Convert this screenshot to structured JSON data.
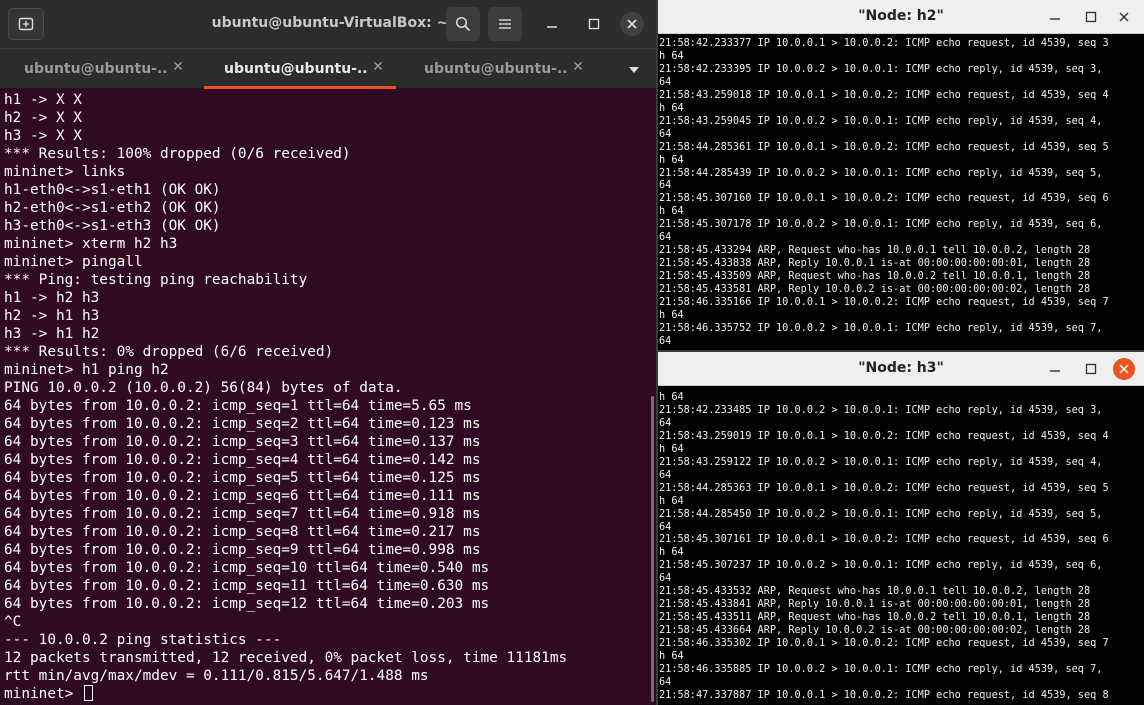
{
  "terminal": {
    "title": "ubuntu@ubuntu-VirtualBox: ~",
    "tabs": [
      {
        "label": "ubuntu@ubuntu-...",
        "active": false
      },
      {
        "label": "ubuntu@ubuntu-...",
        "active": true
      },
      {
        "label": "ubuntu@ubuntu-...",
        "active": false
      }
    ],
    "lines": [
      "h1 -> X X",
      "h2 -> X X",
      "h3 -> X X",
      "*** Results: 100% dropped (0/6 received)",
      "mininet> links",
      "h1-eth0<->s1-eth1 (OK OK)",
      "h2-eth0<->s1-eth2 (OK OK)",
      "h3-eth0<->s1-eth3 (OK OK)",
      "mininet> xterm h2 h3",
      "mininet> pingall",
      "*** Ping: testing ping reachability",
      "h1 -> h2 h3",
      "h2 -> h1 h3",
      "h3 -> h1 h2",
      "*** Results: 0% dropped (6/6 received)",
      "mininet> h1 ping h2",
      "PING 10.0.0.2 (10.0.0.2) 56(84) bytes of data.",
      "64 bytes from 10.0.0.2: icmp_seq=1 ttl=64 time=5.65 ms",
      "64 bytes from 10.0.0.2: icmp_seq=2 ttl=64 time=0.123 ms",
      "64 bytes from 10.0.0.2: icmp_seq=3 ttl=64 time=0.137 ms",
      "64 bytes from 10.0.0.2: icmp_seq=4 ttl=64 time=0.142 ms",
      "64 bytes from 10.0.0.2: icmp_seq=5 ttl=64 time=0.125 ms",
      "64 bytes from 10.0.0.2: icmp_seq=6 ttl=64 time=0.111 ms",
      "64 bytes from 10.0.0.2: icmp_seq=7 ttl=64 time=0.918 ms",
      "64 bytes from 10.0.0.2: icmp_seq=8 ttl=64 time=0.217 ms",
      "64 bytes from 10.0.0.2: icmp_seq=9 ttl=64 time=0.998 ms",
      "64 bytes from 10.0.0.2: icmp_seq=10 ttl=64 time=0.540 ms",
      "64 bytes from 10.0.0.2: icmp_seq=11 ttl=64 time=0.630 ms",
      "64 bytes from 10.0.0.2: icmp_seq=12 ttl=64 time=0.203 ms",
      "^C",
      "--- 10.0.0.2 ping statistics ---",
      "12 packets transmitted, 12 received, 0% packet loss, time 11181ms",
      "rtt min/avg/max/mdev = 0.111/0.815/5.647/1.488 ms"
    ],
    "prompt": "mininet> "
  },
  "node_h2": {
    "title": "\"Node: h2\"",
    "lines": [
      "21:58:42.233377 IP 10.0.0.1 > 10.0.0.2: ICMP echo request, id 4539, seq 3, lengt",
      "h 64",
      "21:58:42.233395 IP 10.0.0.2 > 10.0.0.1: ICMP echo reply, id 4539, seq 3, length",
      "64",
      "21:58:43.259018 IP 10.0.0.1 > 10.0.0.2: ICMP echo request, id 4539, seq 4, lengt",
      "h 64",
      "21:58:43.259045 IP 10.0.0.2 > 10.0.0.1: ICMP echo reply, id 4539, seq 4, length",
      "64",
      "21:58:44.285361 IP 10.0.0.1 > 10.0.0.2: ICMP echo request, id 4539, seq 5, lengt",
      "h 64",
      "21:58:44.285439 IP 10.0.0.2 > 10.0.0.1: ICMP echo reply, id 4539, seq 5, length",
      "64",
      "21:58:45.307160 IP 10.0.0.1 > 10.0.0.2: ICMP echo request, id 4539, seq 6, lengt",
      "h 64",
      "21:58:45.307178 IP 10.0.0.2 > 10.0.0.1: ICMP echo reply, id 4539, seq 6, length",
      "64",
      "21:58:45.433294 ARP, Request who-has 10.0.0.1 tell 10.0.0.2, length 28",
      "21:58:45.433838 ARP, Reply 10.0.0.1 is-at 00:00:00:00:00:01, length 28",
      "21:58:45.433509 ARP, Request who-has 10.0.0.2 tell 10.0.0.1, length 28",
      "21:58:45.433581 ARP, Reply 10.0.0.2 is-at 00:00:00:00:00:02, length 28",
      "21:58:46.335166 IP 10.0.0.1 > 10.0.0.2: ICMP echo request, id 4539, seq 7, lengt",
      "h 64",
      "21:58:46.335752 IP 10.0.0.2 > 10.0.0.1: ICMP echo reply, id 4539, seq 7, length",
      "64"
    ]
  },
  "node_h3": {
    "title": "\"Node: h3\"",
    "lines": [
      "h 64",
      "21:58:42.233485 IP 10.0.0.2 > 10.0.0.1: ICMP echo reply, id 4539, seq 3, length",
      "64",
      "21:58:43.259019 IP 10.0.0.1 > 10.0.0.2: ICMP echo request, id 4539, seq 4, lengt",
      "h 64",
      "21:58:43.259122 IP 10.0.0.2 > 10.0.0.1: ICMP echo reply, id 4539, seq 4, length",
      "64",
      "21:58:44.285363 IP 10.0.0.1 > 10.0.0.2: ICMP echo request, id 4539, seq 5, lengt",
      "h 64",
      "21:58:44.285450 IP 10.0.0.2 > 10.0.0.1: ICMP echo reply, id 4539, seq 5, length",
      "64",
      "21:58:45.307161 IP 10.0.0.1 > 10.0.0.2: ICMP echo request, id 4539, seq 6, lengt",
      "h 64",
      "21:58:45.307237 IP 10.0.0.2 > 10.0.0.1: ICMP echo reply, id 4539, seq 6, length",
      "64",
      "21:58:45.433532 ARP, Request who-has 10.0.0.1 tell 10.0.0.2, length 28",
      "21:58:45.433841 ARP, Reply 10.0.0.1 is-at 00:00:00:00:00:01, length 28",
      "21:58:45.433511 ARP, Request who-has 10.0.0.2 tell 10.0.0.1, length 28",
      "21:58:45.433664 ARP, Reply 10.0.0.2 is-at 00:00:00:00:00:02, length 28",
      "21:58:46.335302 IP 10.0.0.1 > 10.0.0.2: ICMP echo request, id 4539, seq 7, lengt",
      "h 64",
      "21:58:46.335885 IP 10.0.0.2 > 10.0.0.1: ICMP echo reply, id 4539, seq 7, length",
      "64",
      "21:58:47.337887 IP 10.0.0.1 > 10.0.0.2: ICMP echo request, id 4539, seq 8, lengt"
    ]
  },
  "icons": {
    "new_tab": "new-tab-icon",
    "search": "search-icon",
    "menu": "hamburger-menu-icon",
    "minimize": "minimize-icon",
    "maximize": "maximize-icon",
    "close": "close-icon",
    "tabs_dropdown": "chevron-down-icon"
  },
  "colors": {
    "terminal_bg": "#300a24",
    "accent": "#e95420",
    "xterm_bg": "#000000"
  }
}
